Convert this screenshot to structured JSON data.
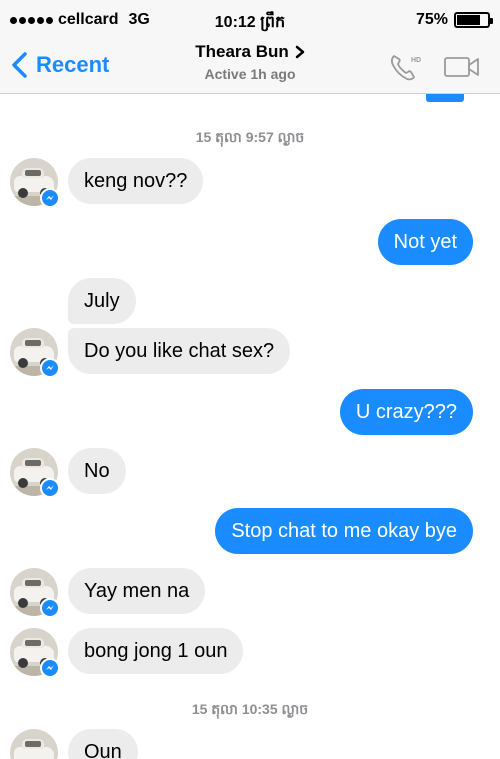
{
  "status_bar": {
    "carrier": "cellcard",
    "network": "3G",
    "time": "10:12 ព្រឹក",
    "battery_text": "75%",
    "battery_level": 0.75
  },
  "nav": {
    "back_label": "Recent",
    "contact_name": "Theara Bun",
    "active_status": "Active 1h ago",
    "call_hd_label": "HD"
  },
  "conversation": {
    "timestamp_1": "15 តុលា 9:57 ល្ងាច",
    "timestamp_2": "15 តុលា 10:35 ល្ងាច",
    "messages": [
      {
        "from": "them",
        "text": "keng nov??"
      },
      {
        "from": "me",
        "text": "Not yet"
      },
      {
        "from": "them",
        "text": "July"
      },
      {
        "from": "them",
        "text": "Do you like chat sex?"
      },
      {
        "from": "me",
        "text": "U crazy???"
      },
      {
        "from": "them",
        "text": "No"
      },
      {
        "from": "me",
        "text": "Stop chat to me okay bye"
      },
      {
        "from": "them",
        "text": "Yay men na"
      },
      {
        "from": "them",
        "text": "bong jong 1 oun"
      },
      {
        "from": "them",
        "text": "Oun"
      }
    ]
  },
  "colors": {
    "accent": "#1a8cff",
    "incoming_bubble": "#ececec",
    "timestamp": "#8e8e93"
  }
}
